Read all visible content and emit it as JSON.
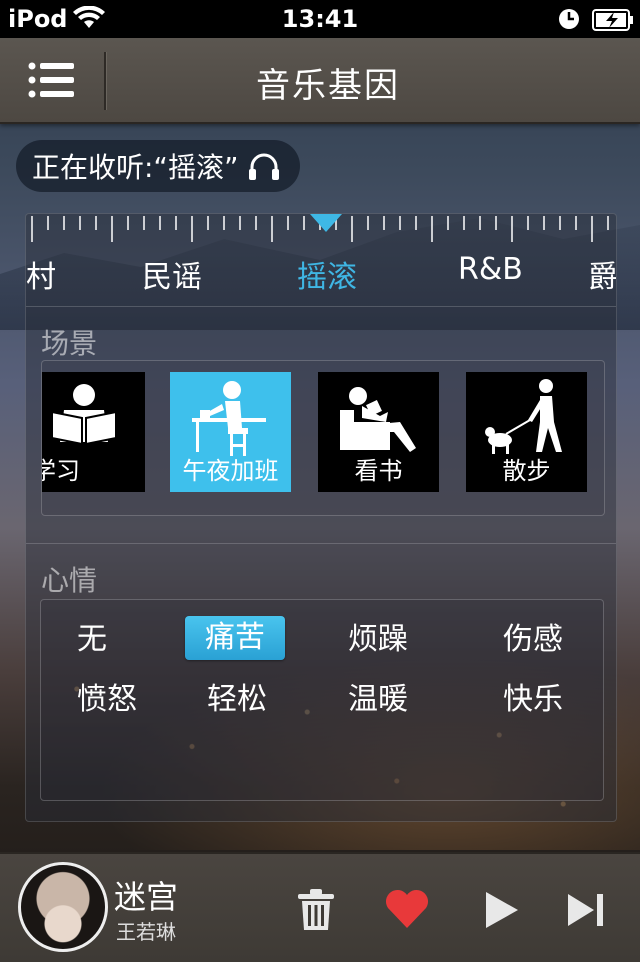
{
  "status_bar": {
    "carrier": "iPod",
    "time": "13:41"
  },
  "header": {
    "title": "音乐基因"
  },
  "now_listening": {
    "text": "正在收听:“摇滚”"
  },
  "genres": {
    "items": [
      "乡村",
      "民谣",
      "摇滚",
      "R&B",
      "爵"
    ],
    "selected": "摇滚"
  },
  "scene_section": {
    "title": "场景",
    "items": [
      "学习",
      "午夜加班",
      "看书",
      "散步"
    ],
    "selected": "午夜加班"
  },
  "mood_section": {
    "title": "心情",
    "items": [
      "无",
      "痛苦",
      "烦躁",
      "伤感",
      "愤怒",
      "轻松",
      "温暖",
      "快乐"
    ],
    "selected": "痛苦"
  },
  "player": {
    "song_title": "迷宫",
    "artist": "王若琳"
  },
  "colors": {
    "accent": "#3fb6e4",
    "heart": "#e8393a"
  }
}
